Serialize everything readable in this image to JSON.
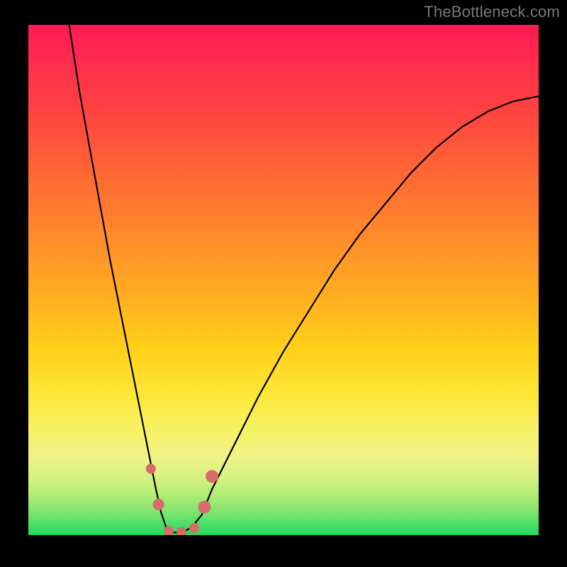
{
  "watermark": "TheBottleneck.com",
  "colors": {
    "frame": "#000000",
    "watermark_text": "#7a7a7a",
    "curve_stroke": "#000000",
    "dot_fill": "#d86a6a",
    "gradient_stops": [
      "#ff1a55",
      "#ff2f4d",
      "#ff4540",
      "#ff6a34",
      "#ff8c2a",
      "#ffb020",
      "#ffd21a",
      "#fce83a",
      "#f6f26a",
      "#eef388",
      "#d4f17f",
      "#b3ec77",
      "#86e670",
      "#54df6a",
      "#20d865"
    ]
  },
  "chart_data": {
    "type": "line",
    "title": "",
    "xlabel": "",
    "ylabel": "",
    "xlim": [
      0,
      100
    ],
    "ylim": [
      0,
      100
    ],
    "grid": false,
    "legend": false,
    "annotations": [],
    "note": "Axes are unlabeled in the source image; values are proportional (0-100) estimates read from pixel positions.",
    "series": [
      {
        "name": "bottleneck-curve",
        "x": [
          8,
          10,
          12,
          14,
          16,
          18,
          20,
          22,
          24,
          25,
          26,
          27,
          28,
          30,
          32,
          34,
          36,
          40,
          45,
          50,
          55,
          60,
          65,
          70,
          75,
          80,
          85,
          90,
          95,
          100
        ],
        "y": [
          100,
          87,
          76,
          65,
          54,
          44,
          34,
          24,
          14,
          9,
          4.5,
          1.5,
          0.5,
          0.5,
          1.5,
          4,
          9,
          17,
          27,
          36,
          44,
          52,
          59,
          65,
          71,
          76,
          80,
          83,
          85,
          86
        ]
      }
    ],
    "markers": [
      {
        "name": "dot-left-upper",
        "x": 24.0,
        "y": 13.0,
        "r": 7
      },
      {
        "name": "dot-left-mid",
        "x": 25.5,
        "y": 6.0,
        "r": 8
      },
      {
        "name": "dot-bottom-a",
        "x": 27.5,
        "y": 0.8,
        "r": 7
      },
      {
        "name": "dot-bottom-b",
        "x": 30.0,
        "y": 0.6,
        "r": 7
      },
      {
        "name": "dot-bottom-c",
        "x": 32.5,
        "y": 1.4,
        "r": 7
      },
      {
        "name": "dot-right-mid",
        "x": 34.5,
        "y": 5.5,
        "r": 9
      },
      {
        "name": "dot-right-upper",
        "x": 36.0,
        "y": 11.5,
        "r": 9
      }
    ]
  }
}
